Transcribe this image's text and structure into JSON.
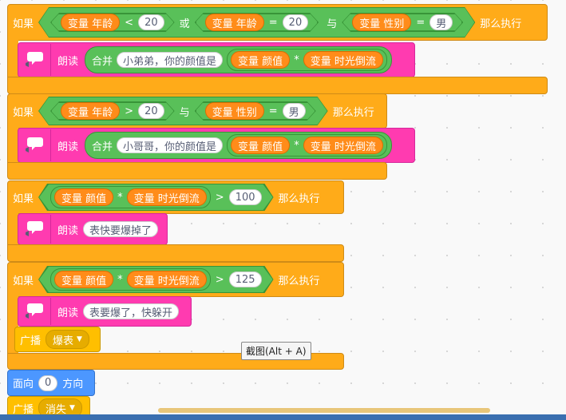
{
  "kw": {
    "if": "如果",
    "then": "那么执行",
    "or": "或",
    "and": "与",
    "speak": "朗读",
    "join": "合并",
    "broadcast": "广播",
    "point": "面向",
    "direction": "方向"
  },
  "vars": {
    "age": "变量 年龄",
    "gender": "变量 性别",
    "looks": "变量 颜值",
    "time": "变量 时光倒流"
  },
  "ops": {
    "lt": "<",
    "gt": ">",
    "eq": "=",
    "mul": "*"
  },
  "block1": {
    "v1": "20",
    "v2": "20",
    "v3": "男",
    "say": "小弟弟，你的颜值是"
  },
  "block2": {
    "v1": "20",
    "v2": "男",
    "say": "小哥哥，你的颜值是"
  },
  "block3": {
    "v1": "100",
    "say": "表快要爆掉了"
  },
  "block4": {
    "v1": "125",
    "say": "表要爆了，快躲开",
    "msg": "爆表"
  },
  "tail": {
    "dir": "0",
    "msg": "消失"
  },
  "tooltip": "截图(Alt + A)"
}
